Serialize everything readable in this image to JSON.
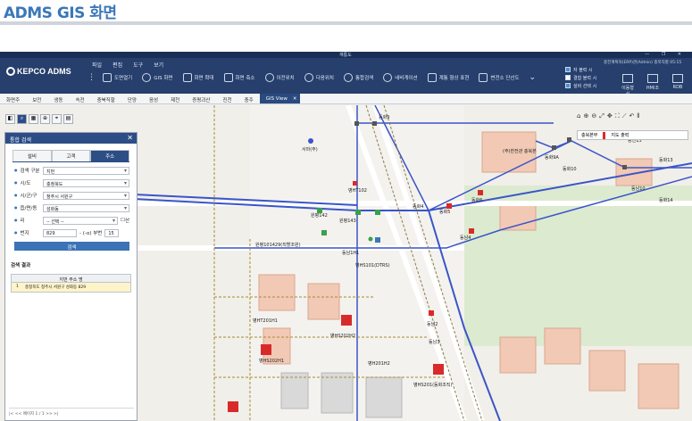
{
  "page": {
    "heading": "ADMS GIS 화면"
  },
  "window": {
    "title": "계통도",
    "controls": "— ❐ ✕"
  },
  "header": {
    "logo_text": "KEPCO ADMS",
    "menu": [
      "파일",
      "편집",
      "도구",
      "보기"
    ],
    "user_info": "충전계획처(ERP)관(Admin) 충북직할 05:15",
    "tools": [
      {
        "label": "도면열기",
        "icon": "map-open-icon"
      },
      {
        "label": "GIS 화면",
        "icon": "pin-icon"
      },
      {
        "label": "화면 확대",
        "icon": "zoom-in-icon"
      },
      {
        "label": "화면 축소",
        "icon": "zoom-out-icon"
      },
      {
        "label": "이전위치",
        "icon": "prev-location-icon"
      },
      {
        "label": "다음위치",
        "icon": "next-location-icon"
      },
      {
        "label": "통합검색",
        "icon": "search-icon"
      },
      {
        "label": "네비게이션",
        "icon": "navigation-icon"
      },
      {
        "label": "계통 형상 표현",
        "icon": "topology-icon"
      },
      {
        "label": "변전소 단선도",
        "icon": "substation-icon"
      }
    ],
    "checks": [
      {
        "label": "자 블럭 시",
        "checked": true
      },
      {
        "label": "결합 블럭 시",
        "checked": false
      },
      {
        "label": "설비 선택 시",
        "checked": true
      }
    ],
    "right_buttons": [
      "이동형식",
      "HMI조",
      "RDB"
    ]
  },
  "tabs": [
    {
      "label": "화면주",
      "active": false
    },
    {
      "label": "보전",
      "active": false
    },
    {
      "label": "생동",
      "active": false
    },
    {
      "label": "속전",
      "active": false
    },
    {
      "label": "충북직할",
      "active": false
    },
    {
      "label": "단양",
      "active": false
    },
    {
      "label": "음성",
      "active": false
    },
    {
      "label": "제천",
      "active": false
    },
    {
      "label": "증평괴산",
      "active": false
    },
    {
      "label": "진천",
      "active": false
    },
    {
      "label": "충주",
      "active": false
    },
    {
      "label": "GIS View",
      "active": true
    }
  ],
  "search_panel": {
    "title": "통합 검색",
    "tabs": [
      {
        "label": "설비",
        "active": false
      },
      {
        "label": "고객",
        "active": false
      },
      {
        "label": "주소",
        "active": true
      }
    ],
    "fields": [
      {
        "label": "검색 구분",
        "value": "지번"
      },
      {
        "label": "시/도",
        "value": "충청북도"
      },
      {
        "label": "시/군/구",
        "value": "청주시 서원구"
      },
      {
        "label": "읍/면/동",
        "value": "성화동"
      },
      {
        "label": "리",
        "value": "-- 선택 --",
        "extra": "산"
      }
    ],
    "bunji": {
      "label": "번지",
      "main": "829",
      "sub_label": "- (-o) 부번",
      "sub": "15"
    },
    "search_button": "검색",
    "result_title": "검색 결과",
    "result_header": "지번 주소 명",
    "results": [
      {
        "no": "1",
        "address": "충청북도 청주시 서원구 성화동 829"
      }
    ],
    "pager": "|<  <<  페이지 1  / 1  >>  >|"
  },
  "map_controls": {
    "layer_region": "충북본부",
    "layer_label": "지도 출력"
  },
  "map_labels": [
    {
      "text": "서마(주)"
    },
    {
      "text": "동화9"
    },
    {
      "text": "동화9A"
    },
    {
      "text": "동화10"
    },
    {
      "text": "공천13"
    },
    {
      "text": "동화13"
    },
    {
      "text": "동남10"
    },
    {
      "text": "동화14"
    },
    {
      "text": "(주)한전관 충북본"
    },
    {
      "text": "병HT102"
    },
    {
      "text": "원평142"
    },
    {
      "text": "원평143"
    },
    {
      "text": "동화4"
    },
    {
      "text": "동화5"
    },
    {
      "text": "동화6"
    },
    {
      "text": "동남4"
    },
    {
      "text": "원평101429(직할조원)"
    },
    {
      "text": "동남1H1"
    },
    {
      "text": "병HS101(DTRS)"
    },
    {
      "text": "병HT201H1"
    },
    {
      "text": "병HS202H2"
    },
    {
      "text": "병HS202H1"
    },
    {
      "text": "병H201H2"
    },
    {
      "text": "병HS201(동화조직)"
    },
    {
      "text": "동남2"
    },
    {
      "text": "동남3"
    }
  ]
}
